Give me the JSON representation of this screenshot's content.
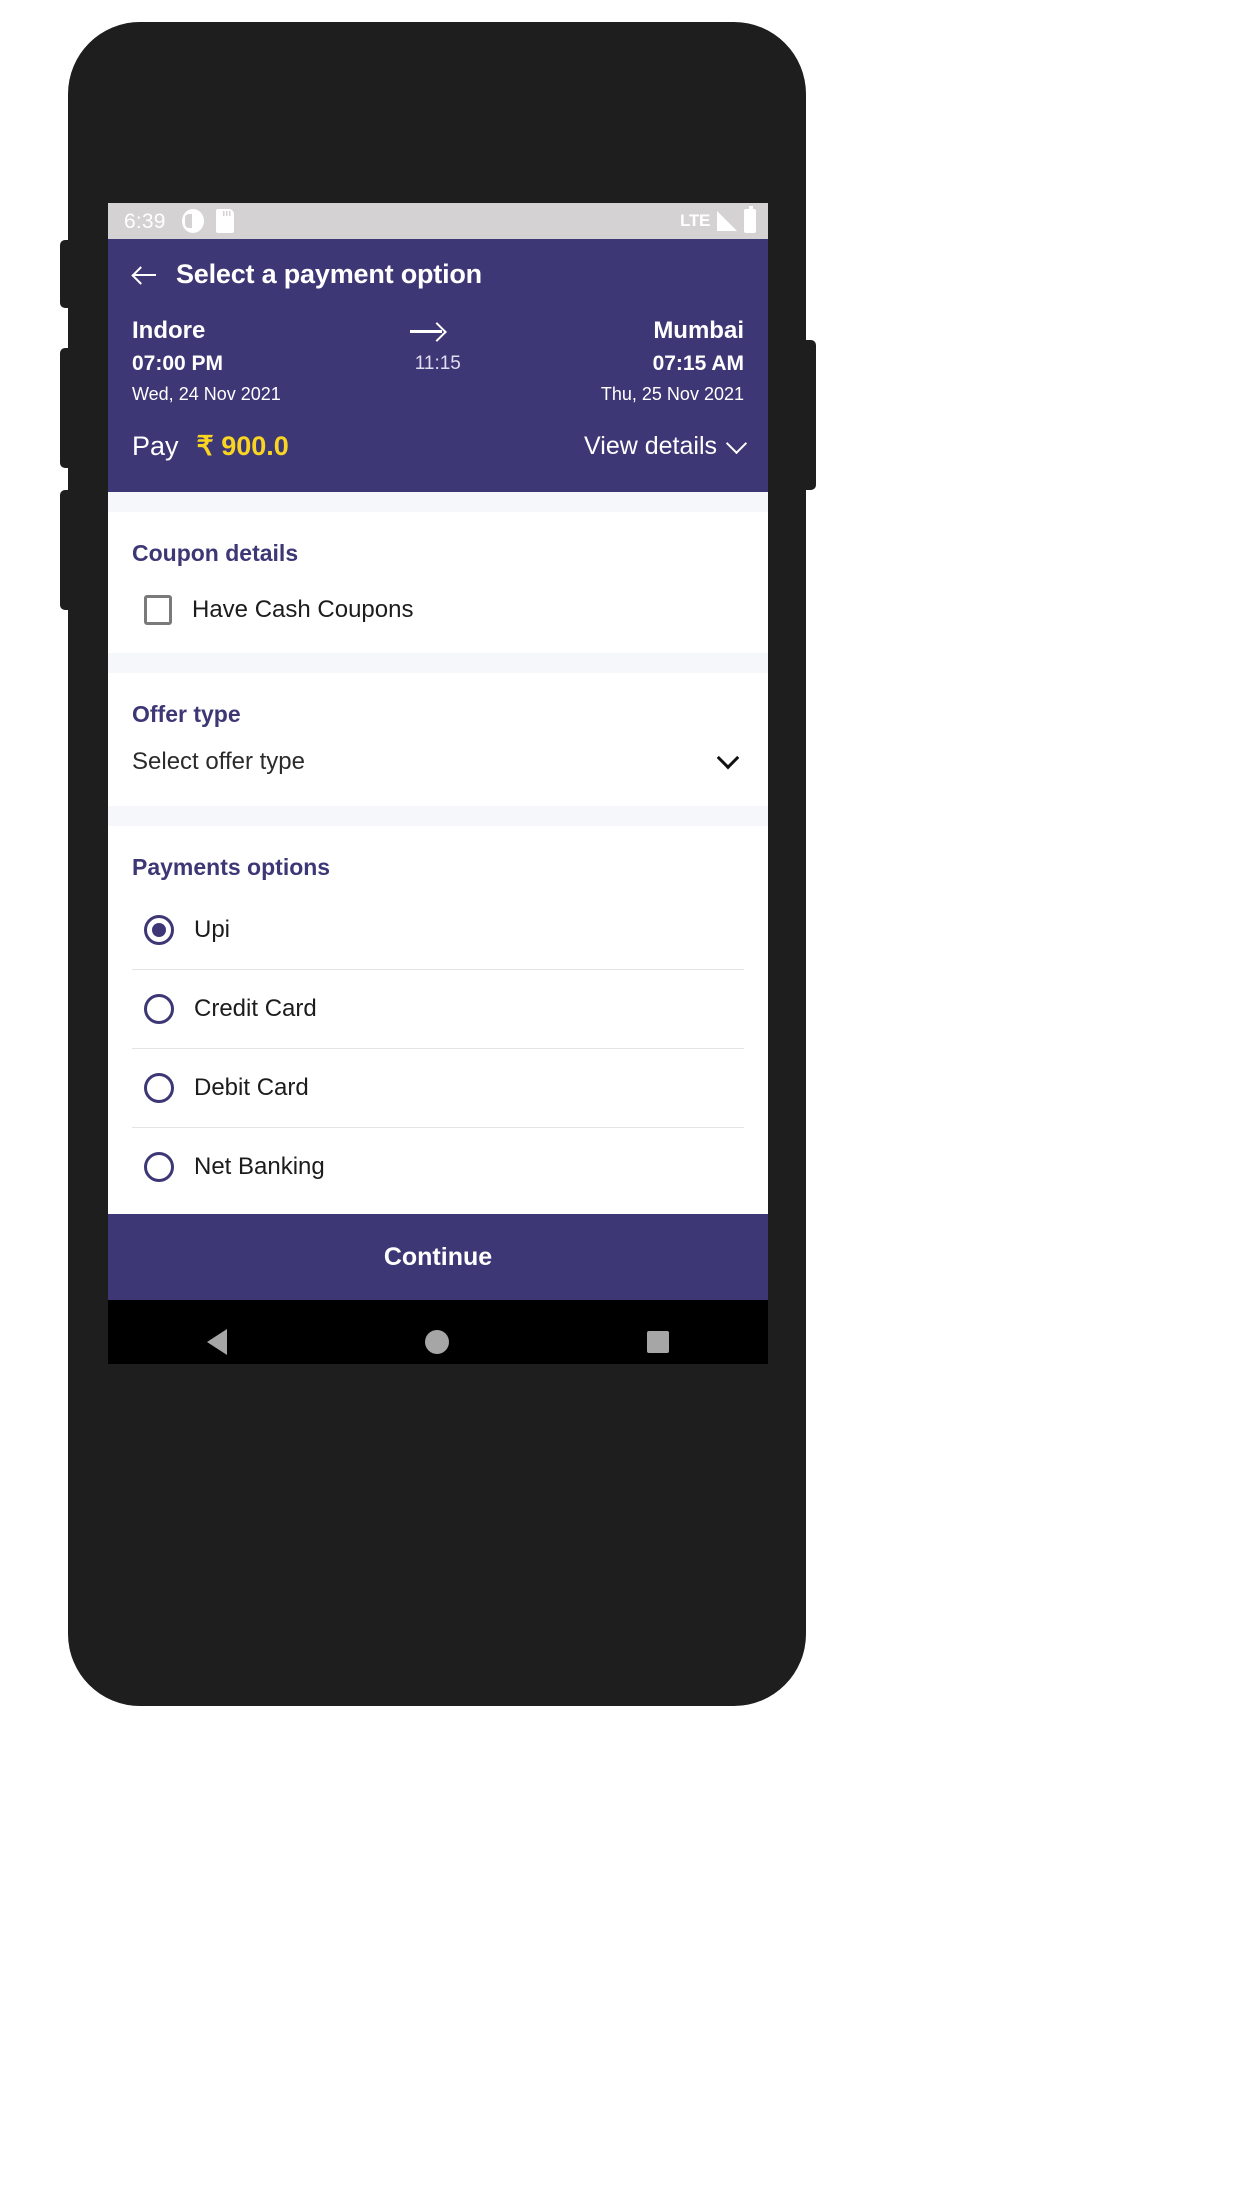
{
  "status_bar": {
    "time": "6:39",
    "network": "LTE",
    "icons": [
      "do-not-disturb-icon",
      "sd-card-icon",
      "signal-icon",
      "battery-icon"
    ]
  },
  "app_bar": {
    "back_icon": "arrow-left-icon",
    "title": "Select a payment option"
  },
  "journey": {
    "origin": "Indore",
    "destination": "Mumbai",
    "departure_time": "07:00 PM",
    "arrival_time": "07:15 AM",
    "duration": "11:15",
    "departure_date": "Wed, 24 Nov 2021",
    "arrival_date": "Thu, 25 Nov 2021",
    "arrow_icon": "arrow-right-icon"
  },
  "pay": {
    "label": "Pay",
    "amount": "₹ 900.0",
    "view_details_label": "View details",
    "chevron_icon": "chevron-down-icon"
  },
  "coupon": {
    "title": "Coupon details",
    "checkbox_label": "Have Cash Coupons",
    "checked": false
  },
  "offer": {
    "title": "Offer type",
    "selected": "Select offer type",
    "chevron_icon": "chevron-down-icon"
  },
  "payments": {
    "title": "Payments options",
    "options": [
      {
        "label": "Upi",
        "selected": true
      },
      {
        "label": "Credit Card",
        "selected": false
      },
      {
        "label": "Debit Card",
        "selected": false
      },
      {
        "label": "Net Banking",
        "selected": false
      }
    ]
  },
  "footer": {
    "continue_label": "Continue"
  },
  "nav_bar": {
    "back_icon": "triangle-back-icon",
    "home_icon": "circle-home-icon",
    "recents_icon": "square-recents-icon"
  },
  "colors": {
    "primary": "#3d3776",
    "accent_amount": "#f9d521",
    "status_bar_bg": "#d4d2d3",
    "page_bg": "#f6f7fb"
  }
}
